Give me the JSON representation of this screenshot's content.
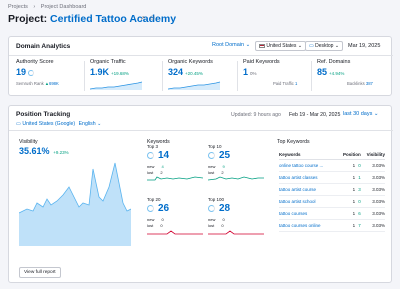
{
  "breadcrumb": [
    "Projects",
    "›",
    "Project Dashboard"
  ],
  "header": {
    "title_prefix": "Project:",
    "project_name": "Certified Tattoo Academy",
    "icons": [
      "external-link-icon",
      "share-icon"
    ]
  },
  "domain_analytics": {
    "title": "Domain Analytics",
    "filters": {
      "root": "Root Domain",
      "country": "United States",
      "device": "Desktop",
      "date": "Mar 19, 2025"
    },
    "metrics": [
      {
        "label": "Authority Score",
        "value": "19",
        "change": "",
        "sub_label": "Semrush Rank",
        "sub_value": "698K"
      },
      {
        "label": "Organic Traffic",
        "value": "1.9K",
        "change": "+19.68%",
        "sub_label": "",
        "sub_value": ""
      },
      {
        "label": "Organic Keywords",
        "value": "324",
        "change": "+20.45%",
        "sub_label": "",
        "sub_value": ""
      },
      {
        "label": "Paid Keywords",
        "value": "1",
        "change": "0%",
        "sub_label": "Paid Traffic",
        "sub_value": "1"
      },
      {
        "label": "Ref. Domains",
        "value": "85",
        "change": "+4.94%",
        "sub_label": "Backlinks",
        "sub_value": "387"
      }
    ]
  },
  "position_tracking": {
    "title": "Position Tracking",
    "updated": "Updated: 9 hours ago",
    "date_range": "Feb 19 - Mar 20, 2025",
    "period": "last 30 days",
    "location": "United States (Google)",
    "language": "English",
    "visibility": {
      "label": "Visibility",
      "value": "35.61%",
      "change": "+9.23%"
    },
    "keywords_title": "Keywords",
    "keyword_groups": [
      {
        "label": "Top 3",
        "value": "14",
        "new_label": "new",
        "new": "4",
        "lost_label": "lost",
        "lost": "2"
      },
      {
        "label": "Top 10",
        "value": "25",
        "new_label": "new",
        "new": "9",
        "lost_label": "lost",
        "lost": "2"
      },
      {
        "label": "Top 20",
        "value": "26",
        "new_label": "new",
        "new": "0",
        "lost_label": "lost",
        "lost": "0"
      },
      {
        "label": "Top 100",
        "value": "28",
        "new_label": "new",
        "new": "0",
        "lost_label": "lost",
        "lost": "0"
      }
    ],
    "top_keywords": {
      "title": "Top Keywords",
      "columns": [
        "Keywords",
        "Position",
        "Visibility"
      ],
      "rows": [
        {
          "keyword": "online tattoo course ...",
          "position": "1",
          "visibility": "3.03%"
        },
        {
          "keyword": "tattoo artist classes",
          "position": "1",
          "visibility": "3.03%"
        },
        {
          "keyword": "tattoo artist course",
          "position": "1",
          "visibility": "3.03%"
        },
        {
          "keyword": "tattoo artist school",
          "position": "1",
          "visibility": "3.03%"
        },
        {
          "keyword": "tattoo courses",
          "position": "1",
          "visibility": "3.03%"
        },
        {
          "keyword": "tattoo courses online",
          "position": "1",
          "visibility": "3.03%"
        }
      ],
      "row_changes": [
        "0",
        "1",
        "3",
        "0",
        "6",
        "7"
      ]
    },
    "view_report": "View full report"
  },
  "colors": {
    "accent": "#006dca",
    "positive": "#009f81",
    "negative": "#d1002f",
    "area": "#bfe1f9"
  }
}
